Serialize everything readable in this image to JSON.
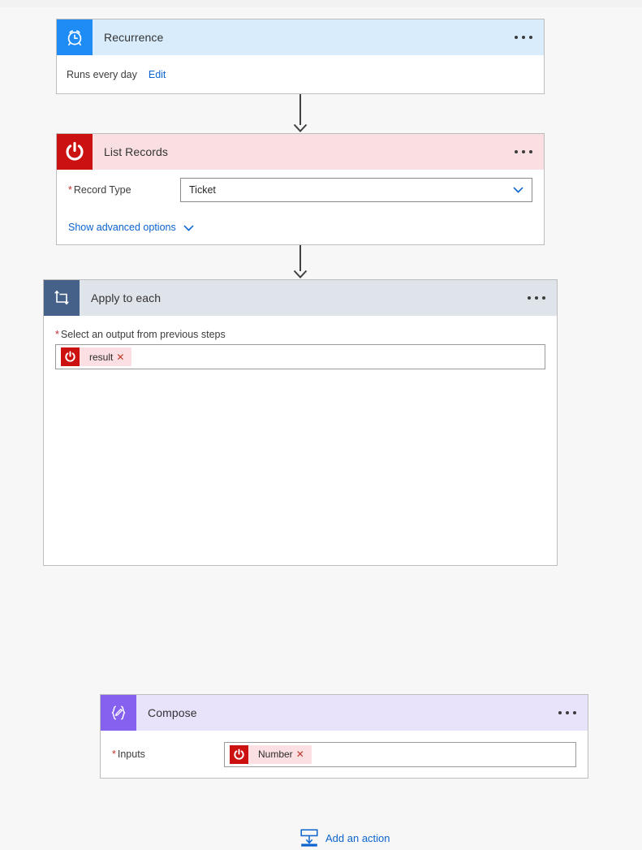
{
  "canvas": {
    "background": "#f7f7f7",
    "top_strip_color": "#f2f2f2"
  },
  "steps": [
    {
      "id": "recurrence",
      "title": "Recurrence",
      "icon": "alarm-clock-icon",
      "header_color": "#d9ecfb",
      "icon_color": "#1f8bf5",
      "menu": "…",
      "summary_text": "Runs every day",
      "edit_link": "Edit"
    },
    {
      "id": "list-records",
      "title": "List Records",
      "icon": "power-icon",
      "header_color": "#f9dfe2",
      "icon_color": "#cc1111",
      "menu": "…",
      "field_label": "Record Type",
      "field_required": "*",
      "field_value": "Ticket",
      "advanced_link": "Show advanced options"
    },
    {
      "id": "apply-to-each",
      "title": "Apply to each",
      "icon": "foreach-loop-icon",
      "header_color": "#dfe3ea",
      "icon_color": "#466189",
      "menu": "…",
      "output_label": "Select an output from previous steps",
      "output_required": "*",
      "token": {
        "text": "result",
        "remove": "✕",
        "icon": "power-icon",
        "icon_color": "#cc1111",
        "chip_color": "#fbdfe2"
      }
    },
    {
      "id": "compose",
      "title": "Compose",
      "icon": "compose-braces-pencil-icon",
      "header_color": "#e9e2fb",
      "icon_color": "#8661f0",
      "menu": "…",
      "field_label": "Inputs",
      "field_required": "*",
      "token": {
        "text": "Number",
        "remove": "✕",
        "icon": "power-icon",
        "icon_color": "#cc1111",
        "chip_color": "#fbdfe2"
      }
    }
  ],
  "add_action": {
    "label": "Add an action",
    "icon": "insert-below-icon",
    "color": "#0b63ce"
  }
}
